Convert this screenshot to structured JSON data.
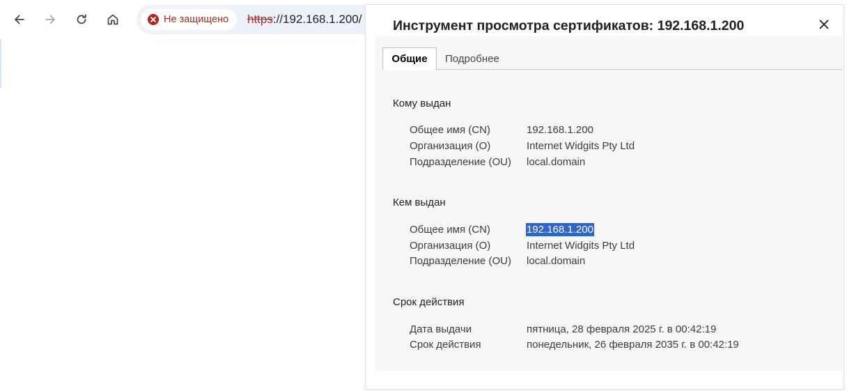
{
  "browser": {
    "security_label": "Не защищено",
    "url_scheme": "https",
    "url_rest": "://192.168.1.200/"
  },
  "dialog": {
    "title": "Инструмент просмотра сертификатов: 192.168.1.200",
    "tabs": [
      {
        "label": "Общие",
        "active": true
      },
      {
        "label": "Подробнее",
        "active": false
      }
    ],
    "issued_to": {
      "heading": "Кому выдан",
      "fields": [
        {
          "label": "Общее имя (CN)",
          "value": "192.168.1.200"
        },
        {
          "label": "Организация (O)",
          "value": "Internet Widgits Pty Ltd"
        },
        {
          "label": "Подразделение (OU)",
          "value": "local.domain"
        }
      ]
    },
    "issued_by": {
      "heading": "Кем выдан",
      "fields": [
        {
          "label": "Общее имя (CN)",
          "value": "192.168.1.200",
          "selected": true
        },
        {
          "label": "Организация (O)",
          "value": "Internet Widgits Pty Ltd"
        },
        {
          "label": "Подразделение (OU)",
          "value": "local.domain"
        }
      ]
    },
    "validity": {
      "heading": "Срок действия",
      "fields": [
        {
          "label": "Дата выдачи",
          "value": "пятница, 28 февраля 2025 г. в 00:42:19"
        },
        {
          "label": "Срок действия",
          "value": "понедельник, 26 февраля 2035 г. в 00:42:19"
        }
      ]
    }
  },
  "colors": {
    "warning": "#b3261e",
    "selection": "#2f64c8",
    "omnibox_bg": "#edf2fa",
    "panel_bg": "#f7f7f7"
  },
  "icons": [
    "back-arrow-icon",
    "forward-arrow-icon",
    "reload-icon",
    "home-icon",
    "not-secure-icon",
    "close-icon"
  ]
}
